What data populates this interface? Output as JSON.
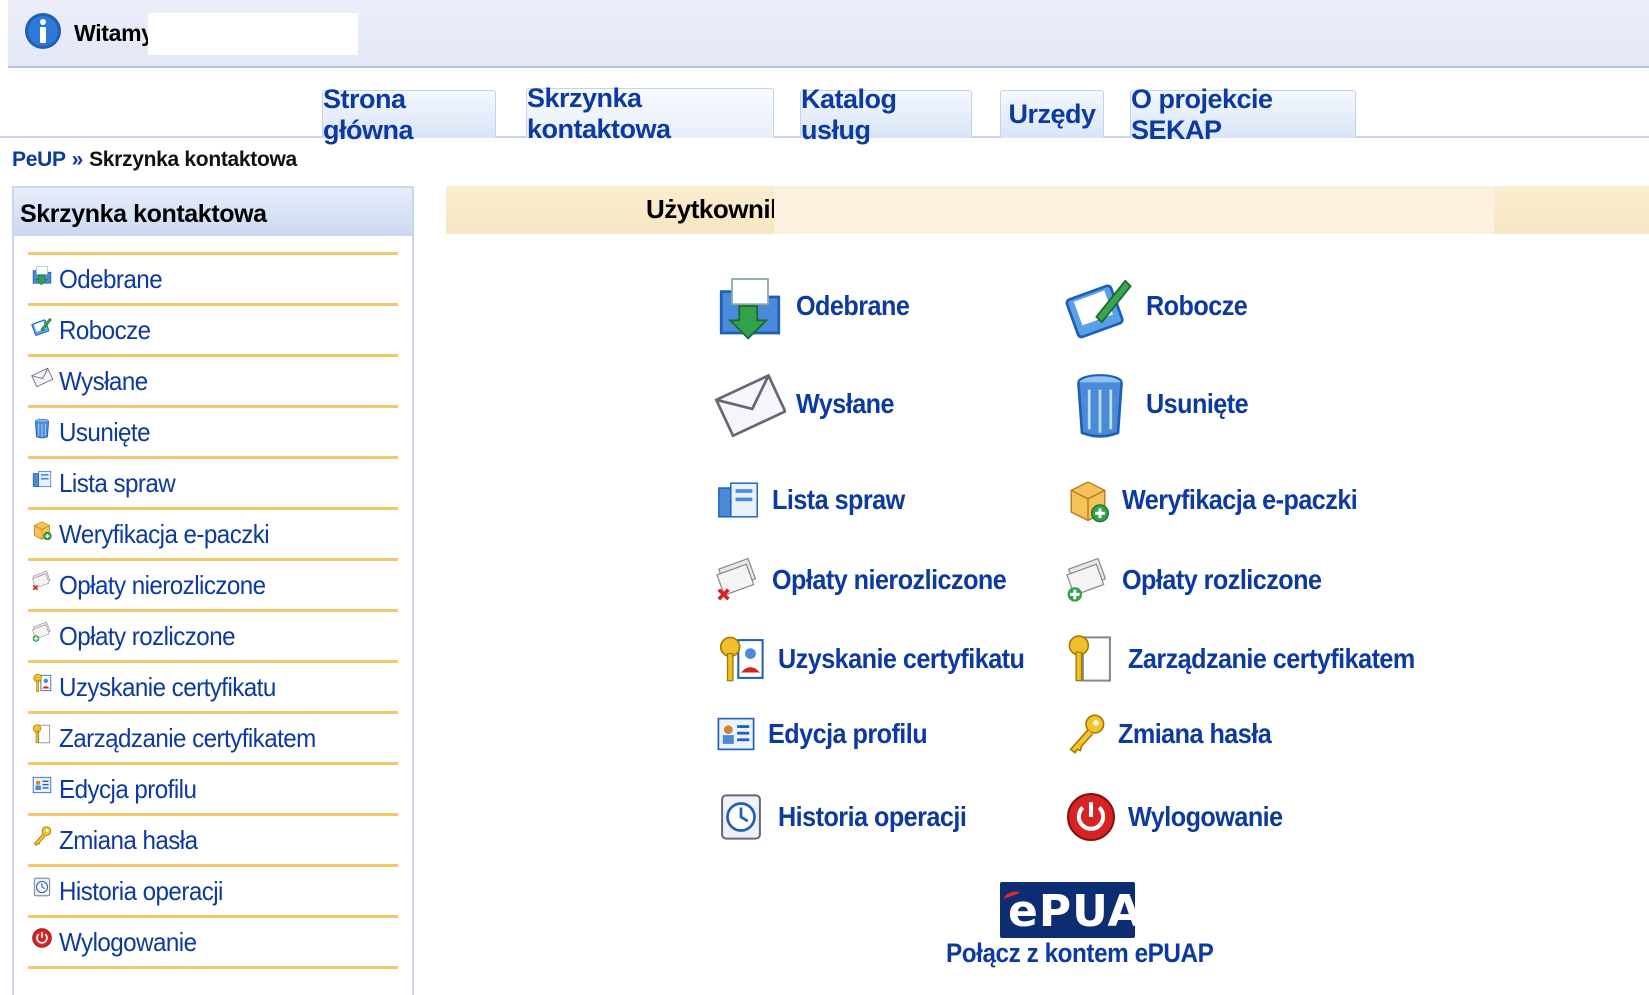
{
  "header": {
    "welcome": "Witamy,"
  },
  "tabs": [
    {
      "label": "Strona główna"
    },
    {
      "label": "Skrzynka kontaktowa",
      "active": true
    },
    {
      "label": "Katalog usług"
    },
    {
      "label": "Urzędy"
    },
    {
      "label": "O projekcie SEKAP"
    }
  ],
  "breadcrumb": {
    "home": "PeUP",
    "sep": "»",
    "current": "Skrzynka kontaktowa"
  },
  "sidebar": {
    "title": "Skrzynka kontaktowa",
    "items": [
      {
        "label": "Odebrane",
        "icon": "inbox-icon"
      },
      {
        "label": "Robocze",
        "icon": "draft-icon"
      },
      {
        "label": "Wysłane",
        "icon": "sent-envelope-icon"
      },
      {
        "label": "Usunięte",
        "icon": "trash-icon"
      },
      {
        "label": "Lista spraw",
        "icon": "case-list-icon"
      },
      {
        "label": "Weryfikacja e-paczki",
        "icon": "package-icon"
      },
      {
        "label": "Opłaty nierozliczone",
        "icon": "unsettled-fees-icon"
      },
      {
        "label": "Opłaty rozliczone",
        "icon": "settled-fees-icon"
      },
      {
        "label": "Uzyskanie certyfikatu",
        "icon": "certificate-obtain-icon"
      },
      {
        "label": "Zarządzanie certyfikatem",
        "icon": "certificate-manage-icon"
      },
      {
        "label": "Edycja profilu",
        "icon": "profile-icon"
      },
      {
        "label": "Zmiana hasła",
        "icon": "key-icon"
      },
      {
        "label": "Historia operacji",
        "icon": "clock-icon"
      },
      {
        "label": "Wylogowanie",
        "icon": "logout-icon"
      }
    ]
  },
  "user": {
    "label": "Użytkownik:"
  },
  "main": {
    "items": [
      {
        "label": "Odebrane",
        "icon": "inbox-icon"
      },
      {
        "label": "Robocze",
        "icon": "draft-icon"
      },
      {
        "label": "Wysłane",
        "icon": "sent-envelope-icon"
      },
      {
        "label": "Usunięte",
        "icon": "trash-icon"
      },
      {
        "label": "Lista spraw",
        "icon": "case-list-icon"
      },
      {
        "label": "Weryfikacja e-paczki",
        "icon": "package-icon"
      },
      {
        "label": "Opłaty nierozliczone",
        "icon": "unsettled-fees-icon"
      },
      {
        "label": "Opłaty rozliczone",
        "icon": "settled-fees-icon"
      },
      {
        "label": "Uzyskanie certyfikatu",
        "icon": "certificate-obtain-icon"
      },
      {
        "label": "Zarządzanie certyfikatem",
        "icon": "certificate-manage-icon"
      },
      {
        "label": "Edycja profilu",
        "icon": "profile-icon"
      },
      {
        "label": "Zmiana hasła",
        "icon": "key-icon"
      },
      {
        "label": "Historia operacji",
        "icon": "clock-icon"
      },
      {
        "label": "Wylogowanie",
        "icon": "logout-icon"
      }
    ]
  },
  "epuap": {
    "logo_text": "ePUAP",
    "link": "Połącz z kontem ePUAP"
  },
  "colors": {
    "link": "#0d3aa1",
    "accent_line": "#f4c66b",
    "user_bar": "#f8ebcc"
  }
}
